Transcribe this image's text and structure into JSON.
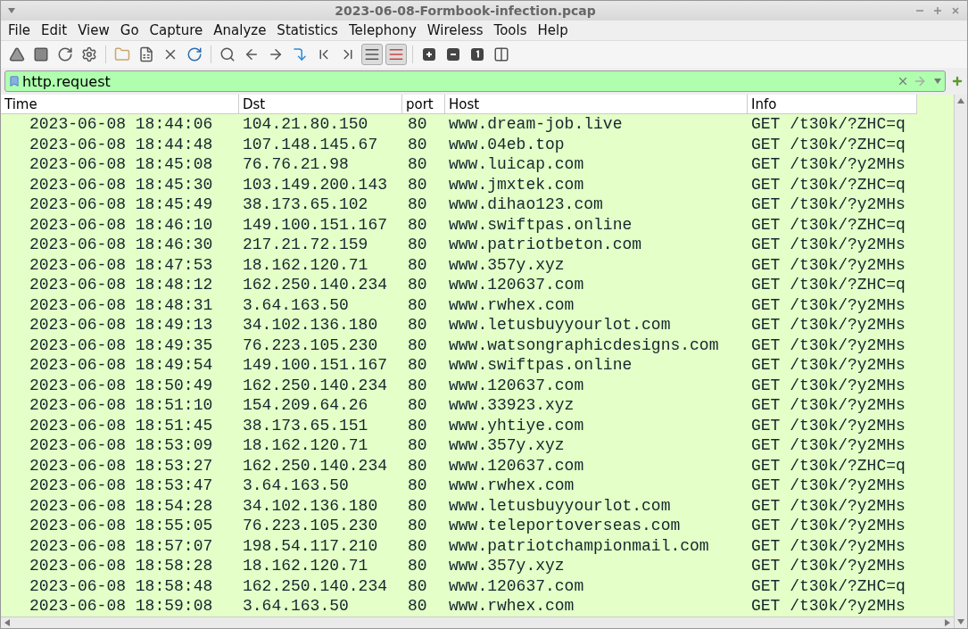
{
  "window": {
    "title": "2023-06-08-Formbook-infection.pcap"
  },
  "menu": [
    "File",
    "Edit",
    "View",
    "Go",
    "Capture",
    "Analyze",
    "Statistics",
    "Telephony",
    "Wireless",
    "Tools",
    "Help"
  ],
  "toolbar": [
    {
      "pressed": false
    },
    {
      "pressed": false
    },
    {
      "pressed": false
    },
    {
      "pressed": false
    },
    {
      "pressed": false
    },
    {
      "pressed": false
    },
    {
      "pressed": false
    },
    {
      "pressed": false
    },
    {
      "pressed": false
    },
    {
      "pressed": false
    },
    {
      "pressed": false
    },
    {
      "pressed": false
    },
    {
      "pressed": false
    },
    {
      "pressed": false
    },
    {
      "pressed": true
    },
    {
      "pressed": true
    },
    {
      "pressed": false
    },
    {
      "pressed": false
    },
    {
      "pressed": false
    },
    {
      "pressed": false
    }
  ],
  "filter": {
    "value": "http.request",
    "valid": true
  },
  "table": {
    "columns": [
      "Time",
      "Dst",
      "port",
      "Host",
      "Info"
    ],
    "rows": [
      [
        "2023-06-08 18:44:06",
        "104.21.80.150",
        "80",
        "www.dream-job.live",
        "GET /t30k/?ZHC=q"
      ],
      [
        "2023-06-08 18:44:48",
        "107.148.145.67",
        "80",
        "www.04eb.top",
        "GET /t30k/?ZHC=q"
      ],
      [
        "2023-06-08 18:45:08",
        "76.76.21.98",
        "80",
        "www.luicap.com",
        "GET /t30k/?y2MHs"
      ],
      [
        "2023-06-08 18:45:30",
        "103.149.200.143",
        "80",
        "www.jmxtek.com",
        "GET /t30k/?ZHC=q"
      ],
      [
        "2023-06-08 18:45:49",
        "38.173.65.102",
        "80",
        "www.dihao123.com",
        "GET /t30k/?y2MHs"
      ],
      [
        "2023-06-08 18:46:10",
        "149.100.151.167",
        "80",
        "www.swiftpas.online",
        "GET /t30k/?ZHC=q"
      ],
      [
        "2023-06-08 18:46:30",
        "217.21.72.159",
        "80",
        "www.patriotbeton.com",
        "GET /t30k/?y2MHs"
      ],
      [
        "2023-06-08 18:47:53",
        "18.162.120.71",
        "80",
        "www.357y.xyz",
        "GET /t30k/?y2MHs"
      ],
      [
        "2023-06-08 18:48:12",
        "162.250.140.234",
        "80",
        "www.120637.com",
        "GET /t30k/?ZHC=q"
      ],
      [
        "2023-06-08 18:48:31",
        "3.64.163.50",
        "80",
        "www.rwhex.com",
        "GET /t30k/?y2MHs"
      ],
      [
        "2023-06-08 18:49:13",
        "34.102.136.180",
        "80",
        "www.letusbuyyourlot.com",
        "GET /t30k/?y2MHs"
      ],
      [
        "2023-06-08 18:49:35",
        "76.223.105.230",
        "80",
        "www.watsongraphicdesigns.com",
        "GET /t30k/?y2MHs"
      ],
      [
        "2023-06-08 18:49:54",
        "149.100.151.167",
        "80",
        "www.swiftpas.online",
        "GET /t30k/?y2MHs"
      ],
      [
        "2023-06-08 18:50:49",
        "162.250.140.234",
        "80",
        "www.120637.com",
        "GET /t30k/?y2MHs"
      ],
      [
        "2023-06-08 18:51:10",
        "154.209.64.26",
        "80",
        "www.33923.xyz",
        "GET /t30k/?y2MHs"
      ],
      [
        "2023-06-08 18:51:45",
        "38.173.65.151",
        "80",
        "www.yhtiye.com",
        "GET /t30k/?y2MHs"
      ],
      [
        "2023-06-08 18:53:09",
        "18.162.120.71",
        "80",
        "www.357y.xyz",
        "GET /t30k/?y2MHs"
      ],
      [
        "2023-06-08 18:53:27",
        "162.250.140.234",
        "80",
        "www.120637.com",
        "GET /t30k/?ZHC=q"
      ],
      [
        "2023-06-08 18:53:47",
        "3.64.163.50",
        "80",
        "www.rwhex.com",
        "GET /t30k/?y2MHs"
      ],
      [
        "2023-06-08 18:54:28",
        "34.102.136.180",
        "80",
        "www.letusbuyyourlot.com",
        "GET /t30k/?y2MHs"
      ],
      [
        "2023-06-08 18:55:05",
        "76.223.105.230",
        "80",
        "www.teleportoverseas.com",
        "GET /t30k/?y2MHs"
      ],
      [
        "2023-06-08 18:57:07",
        "198.54.117.210",
        "80",
        "www.patriotchampionmail.com",
        "GET /t30k/?y2MHs"
      ],
      [
        "2023-06-08 18:58:28",
        "18.162.120.71",
        "80",
        "www.357y.xyz",
        "GET /t30k/?y2MHs"
      ],
      [
        "2023-06-08 18:58:48",
        "162.250.140.234",
        "80",
        "www.120637.com",
        "GET /t30k/?ZHC=q"
      ],
      [
        "2023-06-08 18:59:08",
        "3.64.163.50",
        "80",
        "www.rwhex.com",
        "GET /t30k/?y2MHs"
      ]
    ]
  }
}
